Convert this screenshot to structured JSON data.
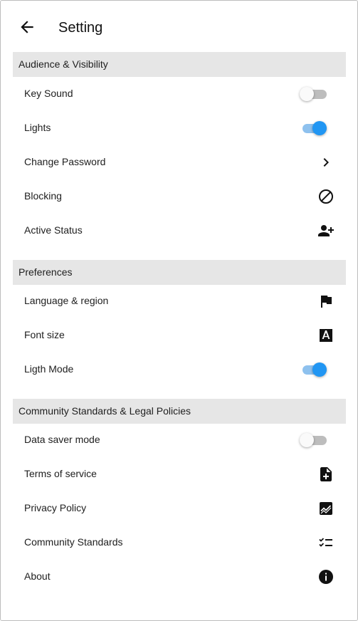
{
  "header": {
    "title": "Setting",
    "back_icon": "arrow-back-icon"
  },
  "sections": [
    {
      "label": "Audience & Visibility",
      "items": [
        {
          "label": "Key Sound",
          "control": "toggle",
          "on": false
        },
        {
          "label": "Lights",
          "control": "toggle",
          "on": true
        },
        {
          "label": "Change Password",
          "control": "icon",
          "icon": "chevron-right-icon"
        },
        {
          "label": "Blocking",
          "control": "icon",
          "icon": "block-icon"
        },
        {
          "label": "Active Status",
          "control": "icon",
          "icon": "person-add-icon"
        }
      ]
    },
    {
      "label": "Preferences",
      "items": [
        {
          "label": "Language & region",
          "control": "icon",
          "icon": "flag-icon"
        },
        {
          "label": "Font size",
          "control": "icon",
          "icon": "font-size-icon"
        },
        {
          "label": "Ligth Mode",
          "control": "toggle",
          "on": true
        }
      ]
    },
    {
      "label": "Community Standards & Legal Policies",
      "items": [
        {
          "label": "Data saver mode",
          "control": "toggle",
          "on": false
        },
        {
          "label": "Terms of service",
          "control": "icon",
          "icon": "note-add-icon"
        },
        {
          "label": "Privacy Policy",
          "control": "icon",
          "icon": "chart-icon"
        },
        {
          "label": "Community Standards",
          "control": "icon",
          "icon": "checklist-icon"
        },
        {
          "label": "About",
          "control": "icon",
          "icon": "info-icon"
        }
      ]
    }
  ],
  "colors": {
    "accent": "#2196f3",
    "accent_track": "#8ec1ee",
    "section_bg": "#e6e6e6",
    "toggle_off_track": "#bdbdbd"
  }
}
